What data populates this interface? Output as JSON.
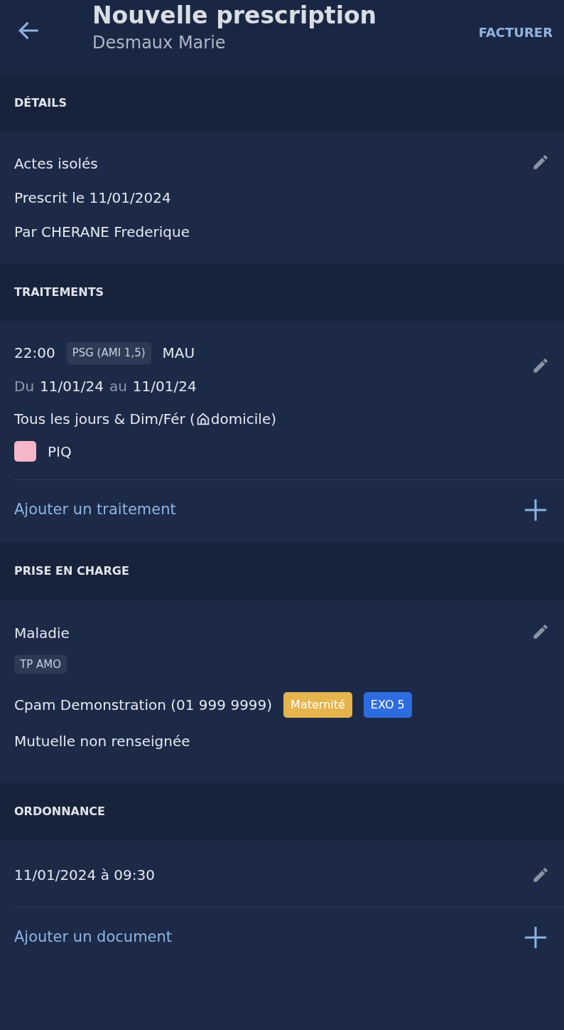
{
  "app_bar": {
    "title": "Nouvelle prescription",
    "subtitle": "Desmaux Marie",
    "action": "FACTURER"
  },
  "sections": [
    {
      "kind": "details",
      "header": "DÉTAILS",
      "lines": [
        "Actes isolés",
        "Prescrit le 11/01/2024",
        "Par CHERANE Frederique"
      ]
    },
    {
      "kind": "treatments",
      "header": "TRAITEMENTS",
      "treatments": [
        {
          "time": "22:00",
          "act": "PSG (AMI 1,5)",
          "code": "MAU",
          "from_label": "Du",
          "from": "11/01/24",
          "to_label": "au",
          "to": "11/01/24",
          "schedule": "Tous les jours & Dim/Fér (",
          "place": "domicile)",
          "tags": [
            {
              "label": "PIQ",
              "color": "#f4b6c8"
            }
          ]
        }
      ],
      "add_label": "Ajouter un traitement"
    },
    {
      "kind": "coverage",
      "header": "PRISE EN CHARGE",
      "regime": "Maladie",
      "chip": "TP AMO",
      "fund": "Cpam Demonstration (01 999 9999)",
      "badges": [
        {
          "label": "Maternité",
          "color": "#e6b44c"
        },
        {
          "label": "EXO 5",
          "color": "#2e6de0"
        }
      ],
      "mutual": "Mutuelle non renseignée"
    },
    {
      "kind": "prescription",
      "header": "ORDONNANCE",
      "date": "11/01/2024 à 09:30",
      "add_label": "Ajouter un document"
    }
  ]
}
